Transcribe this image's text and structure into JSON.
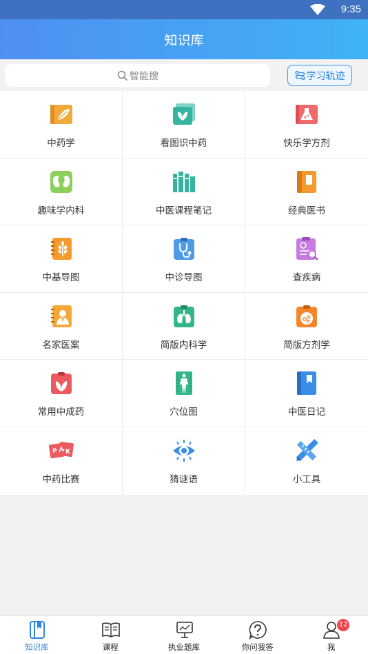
{
  "status_bar": {
    "time": "9:35"
  },
  "header": {
    "title": "知识库"
  },
  "search": {
    "placeholder": "智能搜"
  },
  "track_button": {
    "label": "学习轨迹"
  },
  "grid_items": [
    {
      "label": "中药学",
      "icon": "herb-book-icon"
    },
    {
      "label": "看图识中药",
      "icon": "herb-picture-icon"
    },
    {
      "label": "快乐学方剂",
      "icon": "flask-book-icon"
    },
    {
      "label": "趣味学内科",
      "icon": "kidney-icon"
    },
    {
      "label": "中医课程笔记",
      "icon": "bookshelf-icon"
    },
    {
      "label": "经典医书",
      "icon": "classic-book-icon"
    },
    {
      "label": "中基导图",
      "icon": "wheat-notebook-icon"
    },
    {
      "label": "中诊导图",
      "icon": "stethoscope-icon"
    },
    {
      "label": "查疾病",
      "icon": "search-report-icon"
    },
    {
      "label": "名家医案",
      "icon": "doctor-notebook-icon"
    },
    {
      "label": "简版内科学",
      "icon": "lungs-clipboard-icon"
    },
    {
      "label": "简版方剂学",
      "icon": "pills-clipboard-icon"
    },
    {
      "label": "常用中成药",
      "icon": "leaf-clipboard-icon"
    },
    {
      "label": "穴位图",
      "icon": "acupoint-body-icon"
    },
    {
      "label": "中医日记",
      "icon": "bookmark-diary-icon"
    },
    {
      "label": "中药比赛",
      "icon": "pk-cards-icon"
    },
    {
      "label": "猜谜语",
      "icon": "eye-icon"
    },
    {
      "label": "小工具",
      "icon": "pencil-ruler-icon"
    }
  ],
  "tabs": [
    {
      "label": "知识库",
      "icon": "book-tab-icon",
      "active": true
    },
    {
      "label": "课程",
      "icon": "open-book-icon",
      "active": false
    },
    {
      "label": "执业题库",
      "icon": "presentation-board-icon",
      "active": false
    },
    {
      "label": "你问我答",
      "icon": "question-bubble-icon",
      "active": false
    },
    {
      "label": "我",
      "icon": "user-icon",
      "active": false,
      "badge": "12"
    }
  ],
  "colors": {
    "accent": "#2f86e0",
    "header_start": "#4f8ff0",
    "header_end": "#3fb2f7",
    "badge": "#f0454d"
  }
}
